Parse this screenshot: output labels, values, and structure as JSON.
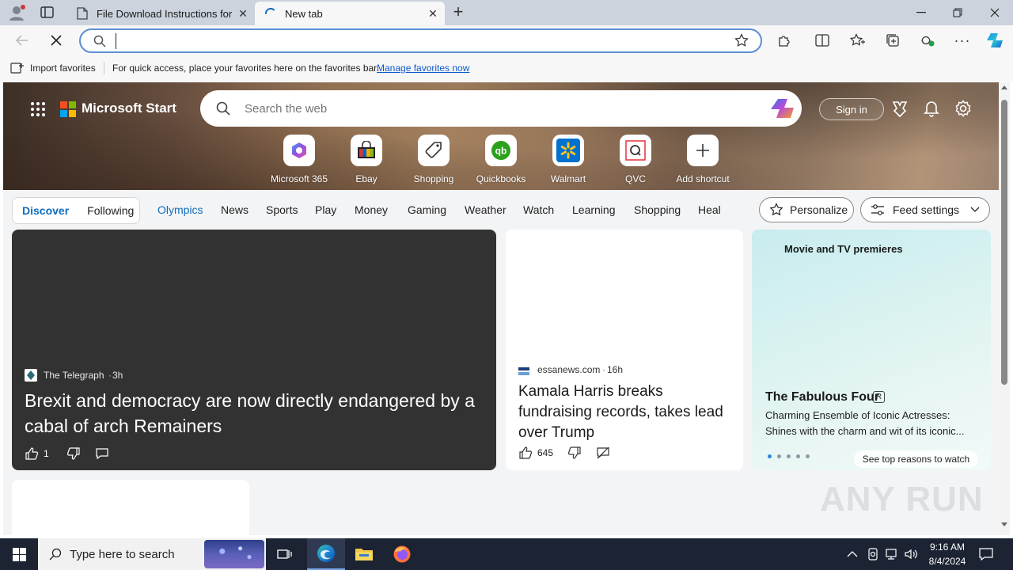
{
  "browser": {
    "tabs": [
      {
        "title": "File Download Instructions for Sa"
      },
      {
        "title": "New tab"
      }
    ],
    "address": {
      "value": "",
      "placeholder": ""
    },
    "favorites_bar": {
      "import_label": "Import favorites",
      "message": "For quick access, place your favorites here on the favorites bar.",
      "manage_link": "Manage favorites now"
    }
  },
  "msn": {
    "brand": "Microsoft Start",
    "search_placeholder": "Search the web",
    "signin_label": "Sign in",
    "shortcuts": [
      {
        "label": "Microsoft 365",
        "icon": "m365-icon"
      },
      {
        "label": "Ebay",
        "icon": "ebay-icon"
      },
      {
        "label": "Shopping",
        "icon": "shopping-tag-icon"
      },
      {
        "label": "Quickbooks",
        "icon": "quickbooks-icon"
      },
      {
        "label": "Walmart",
        "icon": "walmart-icon"
      },
      {
        "label": "QVC",
        "icon": "qvc-icon"
      },
      {
        "label": "Add shortcut",
        "icon": "plus-icon"
      }
    ],
    "feed_toggle": {
      "discover": "Discover",
      "following": "Following"
    },
    "nav": [
      "Olympics",
      "News",
      "Sports",
      "Play",
      "Money",
      "Gaming",
      "Weather",
      "Watch",
      "Learning",
      "Shopping",
      "Heal"
    ],
    "personalize_label": "Personalize",
    "feed_settings_label": "Feed settings",
    "cards": {
      "main": {
        "source": "The Telegraph",
        "age": "3h",
        "headline": "Brexit and democracy are now directly endangered by a cabal of arch Remainers",
        "likes": "1"
      },
      "second": {
        "source": "essanews.com",
        "age": "16h",
        "headline": "Kamala Harris breaks fundraising records, takes lead over Trump",
        "likes": "645"
      },
      "movie": {
        "header": "Movie and TV premieres",
        "title": "The Fabulous Four",
        "rating": "R",
        "line1": "Charming Ensemble of Iconic Actresses:",
        "line2": "Shines with the charm and wit of its iconic...",
        "cta": "See top reasons to watch",
        "active_dot": 1
      }
    }
  },
  "taskbar": {
    "search_placeholder": "Type here to search",
    "time": "9:16 AM",
    "date": "8/4/2024"
  },
  "watermark": "ANY RUN",
  "colors": {
    "accent": "#0f6cbd",
    "taskbar": "#1c2333",
    "card_dark": "#323232"
  }
}
